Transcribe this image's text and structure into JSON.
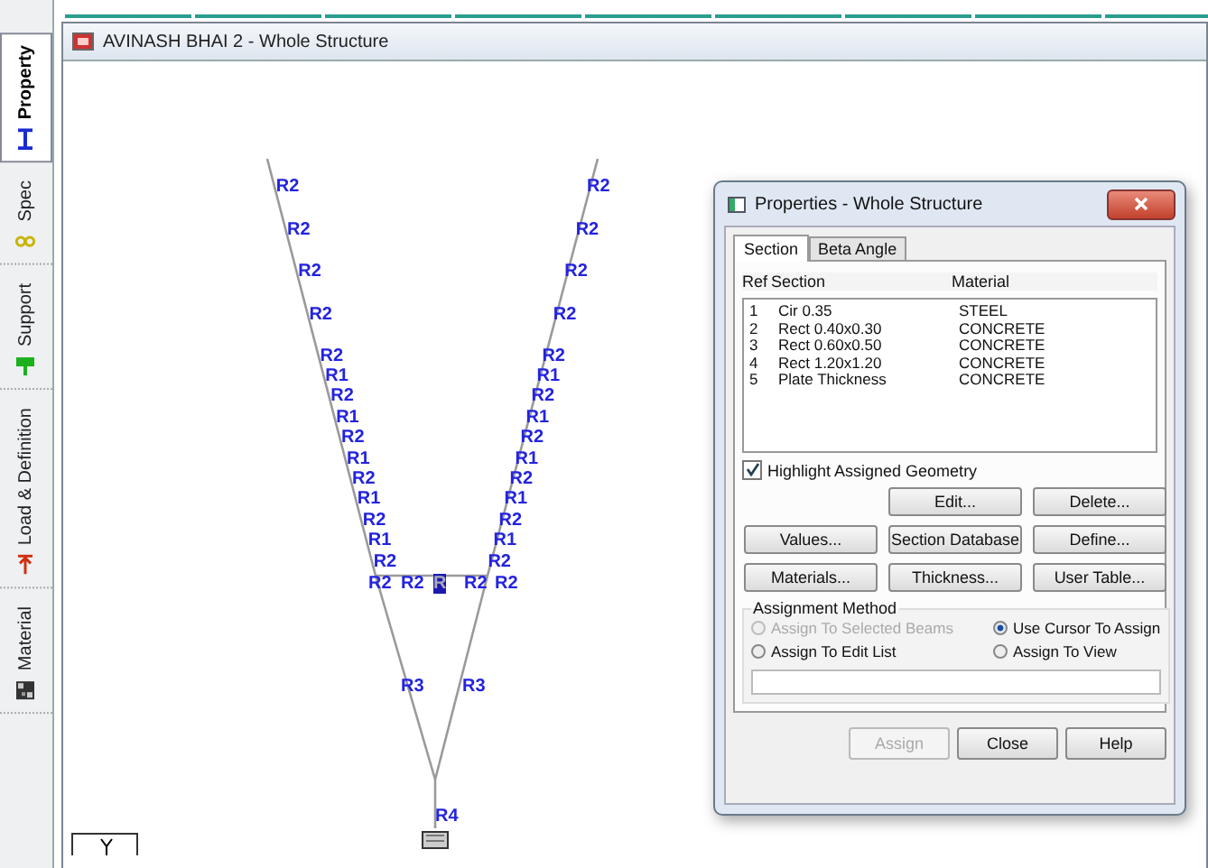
{
  "sidebar": {
    "tabs": [
      {
        "label": "Property",
        "selected": true,
        "kind": "ibeam"
      },
      {
        "label": "Spec",
        "selected": false,
        "kind": "spec"
      },
      {
        "label": "Support",
        "selected": false,
        "kind": "support"
      },
      {
        "label": "Load & Definition",
        "selected": false,
        "kind": "load"
      },
      {
        "label": "Material",
        "selected": false,
        "kind": "material"
      }
    ]
  },
  "view": {
    "title": "AVINASH BHAI 2 - Whole Structure",
    "left_leg": {
      "upper_labels": [
        "R2",
        "R2",
        "R2",
        "R2",
        "R2"
      ],
      "lower_labels": [
        "R1",
        "R2",
        "R1",
        "R2",
        "R1",
        "R2",
        "R1",
        "R2",
        "R1",
        "R2"
      ]
    },
    "right_leg": {
      "upper_labels": [
        "R2",
        "R2",
        "R2",
        "R2",
        "R2"
      ],
      "lower_labels": [
        "R1",
        "R2",
        "R1",
        "R2",
        "R1",
        "R2",
        "R1",
        "R2",
        "R1",
        "R2"
      ]
    },
    "beam_labels": [
      {
        "text": "R2",
        "selected": false
      },
      {
        "text": "R2",
        "selected": false
      },
      {
        "text": "R",
        "selected": true
      },
      {
        "text": "R2",
        "selected": false
      },
      {
        "text": "R2",
        "selected": false
      }
    ],
    "lower_labels": [
      "R3",
      "R3"
    ],
    "column_label": "R4"
  },
  "dialog": {
    "title": "Properties - Whole Structure",
    "tabs": [
      {
        "label": "Section",
        "selected": true
      },
      {
        "label": "Beta Angle",
        "selected": false
      }
    ],
    "columns": [
      "Ref",
      "Section",
      "Material"
    ],
    "rows": [
      {
        "ref": "1",
        "section": "Cir 0.35",
        "material": "STEEL"
      },
      {
        "ref": "2",
        "section": "Rect 0.40x0.30",
        "material": "CONCRETE"
      },
      {
        "ref": "3",
        "section": "Rect 0.60x0.50",
        "material": "CONCRETE"
      },
      {
        "ref": "4",
        "section": "Rect 1.20x1.20",
        "material": "CONCRETE"
      },
      {
        "ref": "5",
        "section": "Plate Thickness",
        "material": "CONCRETE"
      }
    ],
    "highlight": {
      "label": "Highlight Assigned Geometry",
      "checked": true
    },
    "button_rows": [
      [
        "Edit...",
        "Delete..."
      ],
      [
        "Values...",
        "Section Database",
        "Define..."
      ],
      [
        "Materials...",
        "Thickness...",
        "User Table..."
      ]
    ],
    "assignment": {
      "title": "Assignment Method",
      "options": [
        {
          "label": "Assign To Selected Beams",
          "selected": false,
          "disabled": true
        },
        {
          "label": "Use Cursor To Assign",
          "selected": true,
          "disabled": false
        },
        {
          "label": "Assign To Edit List",
          "selected": false,
          "disabled": false
        },
        {
          "label": "Assign To View",
          "selected": false,
          "disabled": false
        }
      ]
    },
    "footer_buttons": [
      {
        "label": "Assign",
        "disabled": true
      },
      {
        "label": "Close",
        "disabled": false
      },
      {
        "label": "Help",
        "disabled": false
      }
    ]
  }
}
